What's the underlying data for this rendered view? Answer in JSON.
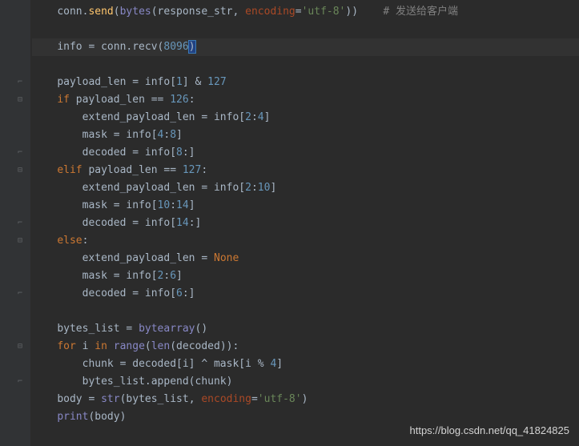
{
  "code": {
    "lines": [
      {
        "indent": 1,
        "segments": [
          {
            "t": "conn.",
            "c": "text"
          },
          {
            "t": "send",
            "c": "func"
          },
          {
            "t": "(",
            "c": "text"
          },
          {
            "t": "bytes",
            "c": "builtin"
          },
          {
            "t": "(response_str",
            "c": "text"
          },
          {
            "t": ", ",
            "c": "text"
          },
          {
            "t": "encoding",
            "c": "param-name"
          },
          {
            "t": "=",
            "c": "text"
          },
          {
            "t": "'utf-8'",
            "c": "str"
          },
          {
            "t": "))    ",
            "c": "text"
          },
          {
            "t": "# 发送给客户端",
            "c": "comment"
          }
        ],
        "fold": null
      },
      {
        "indent": 1,
        "segments": [],
        "fold": null,
        "blank": true
      },
      {
        "indent": 1,
        "segments": [
          {
            "t": "info = conn.recv(",
            "c": "text"
          },
          {
            "t": "8096",
            "c": "num"
          },
          {
            "t": ")",
            "c": "text",
            "cursor": true
          }
        ],
        "fold": null,
        "highlighted": true
      },
      {
        "indent": 1,
        "segments": [],
        "fold": null,
        "blank": true
      },
      {
        "indent": 1,
        "segments": [
          {
            "t": "payload_len = info[",
            "c": "text"
          },
          {
            "t": "1",
            "c": "num"
          },
          {
            "t": "] & ",
            "c": "text"
          },
          {
            "t": "127",
            "c": "num"
          }
        ],
        "fold": "end"
      },
      {
        "indent": 1,
        "segments": [
          {
            "t": "if ",
            "c": "kw"
          },
          {
            "t": "payload_len == ",
            "c": "text"
          },
          {
            "t": "126",
            "c": "num"
          },
          {
            "t": ":",
            "c": "text"
          }
        ],
        "fold": "start"
      },
      {
        "indent": 2,
        "segments": [
          {
            "t": "extend_payload_len = info[",
            "c": "text"
          },
          {
            "t": "2",
            "c": "num"
          },
          {
            "t": ":",
            "c": "text"
          },
          {
            "t": "4",
            "c": "num"
          },
          {
            "t": "]",
            "c": "text"
          }
        ],
        "fold": null
      },
      {
        "indent": 2,
        "segments": [
          {
            "t": "mask = info[",
            "c": "text"
          },
          {
            "t": "4",
            "c": "num"
          },
          {
            "t": ":",
            "c": "text"
          },
          {
            "t": "8",
            "c": "num"
          },
          {
            "t": "]",
            "c": "text"
          }
        ],
        "fold": null
      },
      {
        "indent": 2,
        "segments": [
          {
            "t": "decoded = info[",
            "c": "text"
          },
          {
            "t": "8",
            "c": "num"
          },
          {
            "t": ":]",
            "c": "text"
          }
        ],
        "fold": "end"
      },
      {
        "indent": 1,
        "segments": [
          {
            "t": "elif ",
            "c": "kw"
          },
          {
            "t": "payload_len == ",
            "c": "text"
          },
          {
            "t": "127",
            "c": "num"
          },
          {
            "t": ":",
            "c": "text"
          }
        ],
        "fold": "start"
      },
      {
        "indent": 2,
        "segments": [
          {
            "t": "extend_payload_len = info[",
            "c": "text"
          },
          {
            "t": "2",
            "c": "num"
          },
          {
            "t": ":",
            "c": "text"
          },
          {
            "t": "10",
            "c": "num"
          },
          {
            "t": "]",
            "c": "text"
          }
        ],
        "fold": null
      },
      {
        "indent": 2,
        "segments": [
          {
            "t": "mask = info[",
            "c": "text"
          },
          {
            "t": "10",
            "c": "num"
          },
          {
            "t": ":",
            "c": "text"
          },
          {
            "t": "14",
            "c": "num"
          },
          {
            "t": "]",
            "c": "text"
          }
        ],
        "fold": null
      },
      {
        "indent": 2,
        "segments": [
          {
            "t": "decoded = info[",
            "c": "text"
          },
          {
            "t": "14",
            "c": "num"
          },
          {
            "t": ":]",
            "c": "text"
          }
        ],
        "fold": "end"
      },
      {
        "indent": 1,
        "segments": [
          {
            "t": "else",
            "c": "kw"
          },
          {
            "t": ":",
            "c": "text"
          }
        ],
        "fold": "start"
      },
      {
        "indent": 2,
        "segments": [
          {
            "t": "extend_payload_len = ",
            "c": "text"
          },
          {
            "t": "None",
            "c": "kw"
          }
        ],
        "fold": null
      },
      {
        "indent": 2,
        "segments": [
          {
            "t": "mask = info[",
            "c": "text"
          },
          {
            "t": "2",
            "c": "num"
          },
          {
            "t": ":",
            "c": "text"
          },
          {
            "t": "6",
            "c": "num"
          },
          {
            "t": "]",
            "c": "text"
          }
        ],
        "fold": null
      },
      {
        "indent": 2,
        "segments": [
          {
            "t": "decoded = info[",
            "c": "text"
          },
          {
            "t": "6",
            "c": "num"
          },
          {
            "t": ":]",
            "c": "text"
          }
        ],
        "fold": "end"
      },
      {
        "indent": 1,
        "segments": [],
        "fold": null,
        "blank": true
      },
      {
        "indent": 1,
        "segments": [
          {
            "t": "bytes_list = ",
            "c": "text"
          },
          {
            "t": "bytearray",
            "c": "builtin"
          },
          {
            "t": "()",
            "c": "text"
          }
        ],
        "fold": null
      },
      {
        "indent": 1,
        "segments": [
          {
            "t": "for ",
            "c": "kw"
          },
          {
            "t": "i ",
            "c": "text"
          },
          {
            "t": "in ",
            "c": "kw"
          },
          {
            "t": "range",
            "c": "builtin"
          },
          {
            "t": "(",
            "c": "text"
          },
          {
            "t": "len",
            "c": "builtin"
          },
          {
            "t": "(decoded)):",
            "c": "text"
          }
        ],
        "fold": "start"
      },
      {
        "indent": 2,
        "segments": [
          {
            "t": "chunk = decoded[i] ^ mask[i % ",
            "c": "text"
          },
          {
            "t": "4",
            "c": "num"
          },
          {
            "t": "]",
            "c": "text"
          }
        ],
        "fold": null
      },
      {
        "indent": 2,
        "segments": [
          {
            "t": "bytes_list.append(chunk)",
            "c": "text"
          }
        ],
        "fold": "end"
      },
      {
        "indent": 1,
        "segments": [
          {
            "t": "body = ",
            "c": "text"
          },
          {
            "t": "str",
            "c": "builtin"
          },
          {
            "t": "(bytes_list",
            "c": "text"
          },
          {
            "t": ", ",
            "c": "text"
          },
          {
            "t": "encoding",
            "c": "param-name"
          },
          {
            "t": "=",
            "c": "text"
          },
          {
            "t": "'utf-8'",
            "c": "str"
          },
          {
            "t": ")",
            "c": "text"
          }
        ],
        "fold": null
      },
      {
        "indent": 1,
        "segments": [
          {
            "t": "print",
            "c": "builtin"
          },
          {
            "t": "(body)",
            "c": "text"
          }
        ],
        "fold": null
      }
    ]
  },
  "watermark": "https://blog.csdn.net/qq_41824825",
  "fold_glyphs": {
    "start": "⊟",
    "end": "⌐"
  },
  "indent_unit": "    "
}
